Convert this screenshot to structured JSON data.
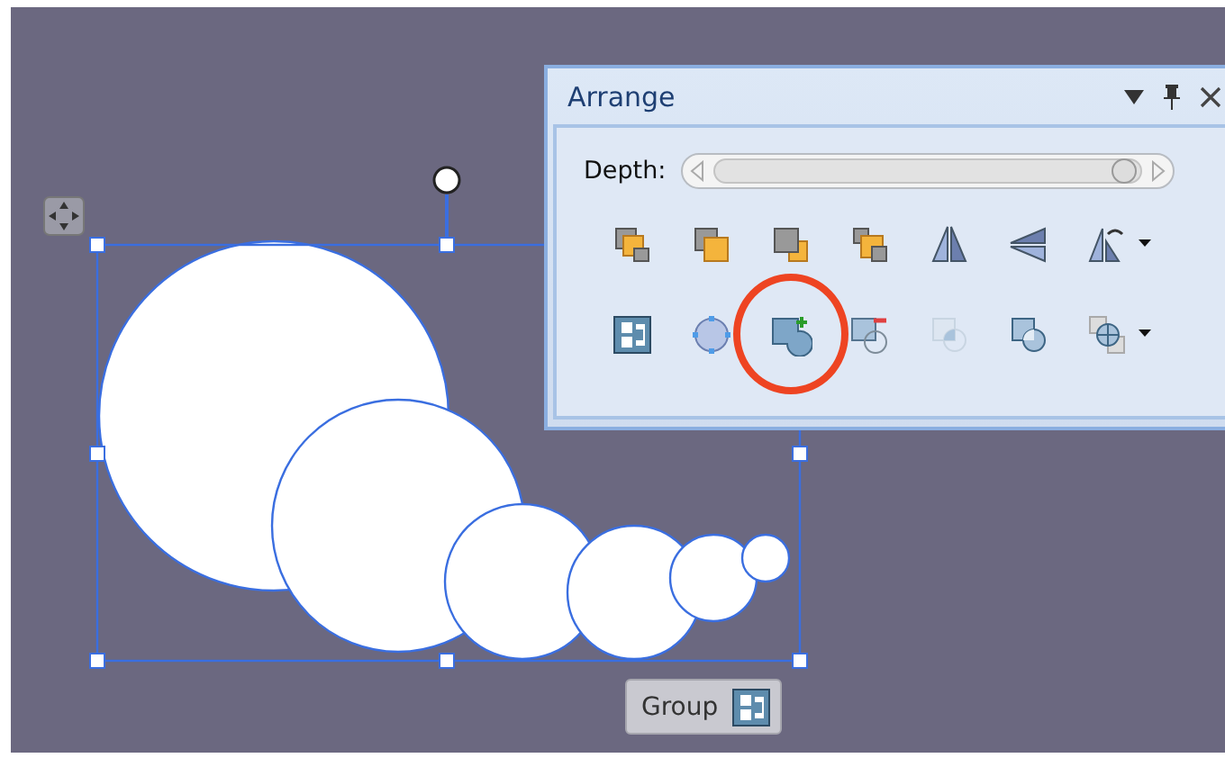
{
  "panel": {
    "title": "Arrange",
    "depth": {
      "label": "Depth:",
      "level": 0.96
    },
    "rows": [
      [
        {
          "kind": "forward",
          "disabled": false,
          "menu": false,
          "circled": false
        },
        {
          "kind": "front",
          "disabled": false,
          "menu": false,
          "circled": false
        },
        {
          "kind": "backward",
          "disabled": false,
          "menu": false,
          "circled": false
        },
        {
          "kind": "back",
          "disabled": false,
          "menu": false,
          "circled": false
        },
        {
          "kind": "flipx",
          "disabled": false,
          "menu": false,
          "circled": false
        },
        {
          "kind": "flipy",
          "disabled": false,
          "menu": false,
          "circled": false
        },
        {
          "kind": "rotate",
          "disabled": false,
          "menu": true,
          "circled": false
        }
      ],
      [
        {
          "kind": "group",
          "disabled": false,
          "menu": false,
          "circled": false
        },
        {
          "kind": "points",
          "disabled": false,
          "menu": false,
          "circled": false
        },
        {
          "kind": "union",
          "disabled": false,
          "menu": false,
          "circled": true
        },
        {
          "kind": "subtract",
          "disabled": false,
          "menu": false,
          "circled": false
        },
        {
          "kind": "intersect",
          "disabled": true,
          "menu": false,
          "circled": false
        },
        {
          "kind": "combine",
          "disabled": false,
          "menu": false,
          "circled": false
        },
        {
          "kind": "fragment",
          "disabled": false,
          "menu": true,
          "circled": false
        }
      ]
    ]
  },
  "group_button": {
    "label": "Group"
  }
}
